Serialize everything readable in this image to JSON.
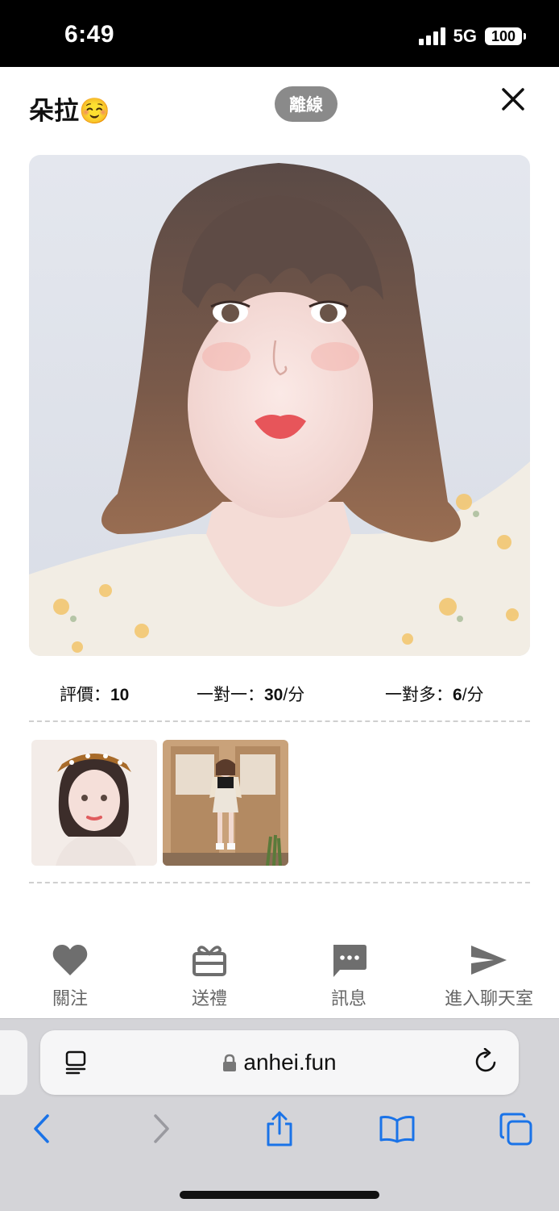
{
  "status_bar": {
    "time": "6:49",
    "network": "5G",
    "battery": "100"
  },
  "header": {
    "name": "朵拉☺️",
    "status": "離線"
  },
  "stats": {
    "rating": {
      "label": "評價：",
      "value": "10"
    },
    "one_on_one": {
      "label": "一對一：",
      "value": "30",
      "unit": "/分"
    },
    "one_to_many": {
      "label": "一對多：",
      "value": "6",
      "unit": "/分"
    }
  },
  "actions": [
    {
      "label": "關注",
      "icon": "heart-icon"
    },
    {
      "label": "送禮",
      "icon": "gift-icon"
    },
    {
      "label": "訊息",
      "icon": "message-icon"
    },
    {
      "label": "進入聊天室",
      "icon": "send-icon"
    }
  ],
  "browser": {
    "url": "anhei.fun"
  },
  "colors": {
    "badge": "#8a8a8a",
    "action_gray": "#6e6e6e",
    "browser_blue": "#1a73e8"
  }
}
